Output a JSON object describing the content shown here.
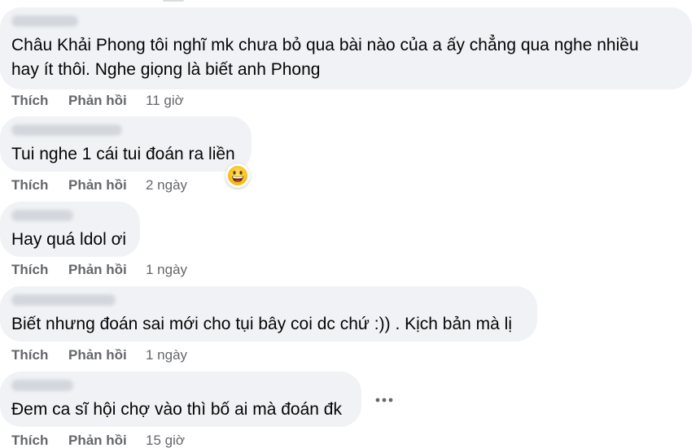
{
  "comments": [
    {
      "text": "Châu Khải Phong tôi nghĩ mk chưa bỏ qua bài nào của a ấy chẳng qua nghe nhiều\nhay ít thôi. Nghe giọng là biết anh Phong",
      "like_label": "Thích",
      "reply_label": "Phản hồi",
      "time": "11 giờ"
    },
    {
      "text": "Tui nghe 1 cái tui đoán ra liền",
      "like_label": "Thích",
      "reply_label": "Phản hồi",
      "time": "2 ngày",
      "reaction_icon": "grinning-face-emoji"
    },
    {
      "text": "Hay quá ldol ơi",
      "like_label": "Thích",
      "reply_label": "Phản hồi",
      "time": "1 ngày"
    },
    {
      "text": "Biết nhưng đoán sai mới cho tụi bây coi dc chứ :)) . Kịch bản mà lị",
      "like_label": "Thích",
      "reply_label": "Phản hồi",
      "time": "1 ngày"
    },
    {
      "text": "Đem ca sĩ hội chợ vào thì bố ai mà đoán đk",
      "like_label": "Thích",
      "reply_label": "Phản hồi",
      "time": "15 giờ"
    }
  ],
  "more_icon": "more-horizontal-icon",
  "colors": {
    "bubble_bg": "#f0f2f5",
    "text": "#050505",
    "secondary_text": "#65676b"
  }
}
